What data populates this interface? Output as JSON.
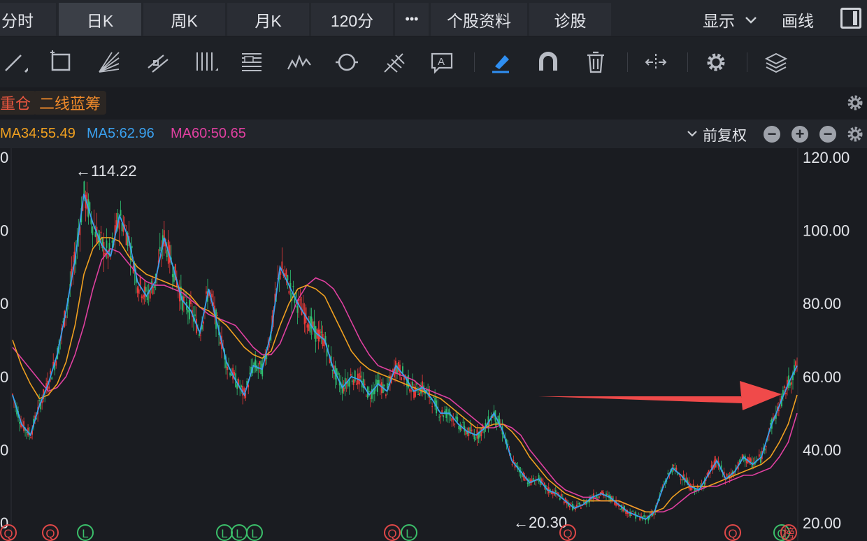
{
  "tabs": [
    {
      "label": "分时",
      "active": false
    },
    {
      "label": "日K",
      "active": true
    },
    {
      "label": "周K",
      "active": false
    },
    {
      "label": "月K",
      "active": false
    },
    {
      "label": "120分",
      "active": false
    },
    {
      "label": "•••",
      "active": false
    },
    {
      "label": "个股资料",
      "active": false
    },
    {
      "label": "诊股",
      "active": false
    }
  ],
  "header_right": {
    "display_label": "显示",
    "draw_label": "画线"
  },
  "tags": [
    {
      "label": "重仓",
      "color": "#e8563f"
    },
    {
      "label": "二线蓝筹",
      "color": "#f08a2a"
    }
  ],
  "ma_legend": [
    {
      "label": "MA34:55.49",
      "color": "#f0a020"
    },
    {
      "label": "MA5:62.96",
      "color": "#3aa0ee"
    },
    {
      "label": "MA60:50.65",
      "color": "#e040a0"
    }
  ],
  "adjust_label": "前复权",
  "chart_data": {
    "type": "candlestick",
    "yaxis_ticks": [
      "120.00",
      "100.00",
      "80.00",
      "60.00",
      "40.00",
      "20.00"
    ],
    "left_ticks": [
      "0",
      "0",
      "0",
      "0",
      "0",
      "0"
    ],
    "ylim": [
      20,
      120
    ],
    "annotations": {
      "high": "←114.22",
      "low": "←20.30"
    },
    "ma5": [
      55,
      47,
      44,
      52,
      58,
      66,
      78,
      92,
      110,
      102,
      96,
      93,
      104,
      98,
      86,
      82,
      86,
      98,
      90,
      81,
      78,
      72,
      84,
      74,
      64,
      59,
      55,
      63,
      62,
      72,
      90,
      85,
      80,
      76,
      72,
      70,
      62,
      57,
      60,
      59,
      55,
      58,
      56,
      63,
      60,
      56,
      57,
      54,
      50,
      50,
      47,
      45,
      44,
      46,
      50,
      45,
      37,
      34,
      31,
      32,
      29,
      28,
      26,
      24,
      25,
      27,
      28,
      27,
      25,
      23,
      22,
      21,
      23,
      30,
      35,
      33,
      30,
      29,
      33,
      37,
      32,
      34,
      38,
      36,
      38,
      46,
      52,
      58,
      63
    ],
    "ma34": [
      70,
      63,
      58,
      54,
      55,
      58,
      64,
      74,
      88,
      95,
      98,
      98,
      97,
      93,
      90,
      88,
      87,
      86,
      85,
      84,
      82,
      79,
      78,
      76,
      74,
      71,
      68,
      66,
      65,
      67,
      74,
      80,
      84,
      85,
      84,
      82,
      77,
      72,
      67,
      64,
      62,
      61,
      60,
      59,
      58,
      57,
      56,
      55,
      54,
      52,
      50,
      48,
      46,
      46,
      47,
      47,
      45,
      42,
      38,
      35,
      32,
      30,
      28,
      27,
      26,
      26,
      26,
      26,
      26,
      25,
      24,
      23,
      23,
      24,
      27,
      29,
      30,
      30,
      30,
      31,
      32,
      33,
      34,
      35,
      36,
      38,
      42,
      47,
      55
    ],
    "ma60": [
      68,
      65,
      62,
      59,
      56,
      57,
      60,
      66,
      74,
      84,
      92,
      95,
      94,
      91,
      88,
      86,
      85,
      85,
      84,
      83,
      81,
      79,
      77,
      76,
      75,
      74,
      71,
      68,
      66,
      66,
      69,
      75,
      81,
      85,
      87,
      86,
      84,
      80,
      75,
      70,
      66,
      63,
      62,
      61,
      60,
      59,
      57,
      56,
      55,
      54,
      52,
      50,
      48,
      46,
      46,
      47,
      46,
      44,
      40,
      37,
      34,
      31,
      29,
      28,
      27,
      27,
      26,
      26,
      26,
      25,
      24,
      23,
      23,
      23,
      24,
      26,
      28,
      29,
      30,
      30,
      31,
      32,
      33,
      33,
      34,
      35,
      38,
      42,
      50
    ],
    "arrow": "pointing to recent breakout"
  }
}
